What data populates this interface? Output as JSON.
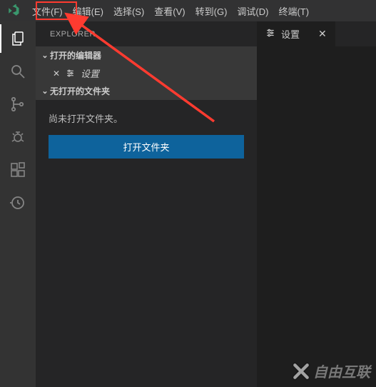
{
  "menubar": {
    "items": [
      "文件(F)",
      "编辑(E)",
      "选择(S)",
      "查看(V)",
      "转到(G)",
      "调试(D)",
      "终端(T)"
    ]
  },
  "activitybar": {
    "icons": [
      "files",
      "search",
      "git",
      "debug",
      "extensions",
      "history"
    ]
  },
  "sidebar": {
    "title": "EXPLORER",
    "open_editors": {
      "label": "打开的编辑器",
      "item_label": "设置"
    },
    "no_folder": {
      "label": "无打开的文件夹"
    }
  },
  "folder_panel": {
    "message": "尚未打开文件夹。",
    "button_label": "打开文件夹"
  },
  "editor": {
    "tab_label": "设置"
  },
  "watermark": {
    "text": "自由互联"
  },
  "colors": {
    "accent": "#0e639c",
    "highlight": "#ff3b30"
  }
}
